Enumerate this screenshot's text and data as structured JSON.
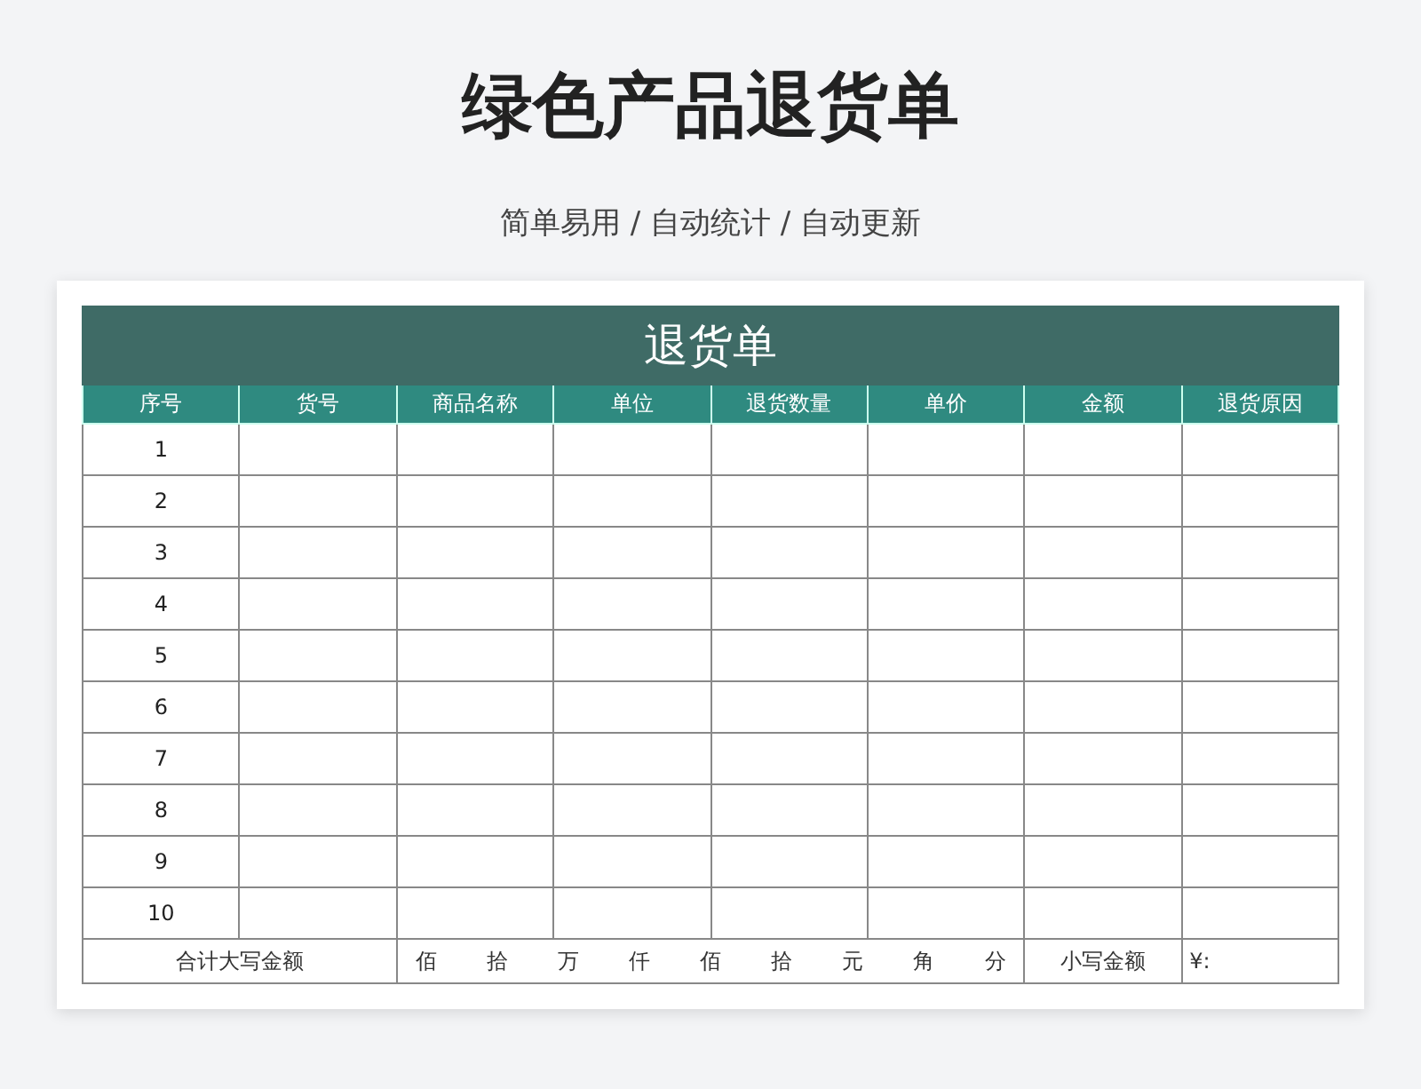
{
  "page": {
    "title": "绿色产品退货单",
    "subtitle": "简单易用 / 自动统计 / 自动更新"
  },
  "sheet": {
    "title": "退货单",
    "columns": [
      "序号",
      "货号",
      "商品名称",
      "单位",
      "退货数量",
      "单价",
      "金额",
      "退货原因"
    ],
    "rows": [
      {
        "number": "1"
      },
      {
        "number": "2"
      },
      {
        "number": "3"
      },
      {
        "number": "4"
      },
      {
        "number": "5"
      },
      {
        "number": "6"
      },
      {
        "number": "7"
      },
      {
        "number": "8"
      },
      {
        "number": "9"
      },
      {
        "number": "10"
      }
    ],
    "total": {
      "label": "合计大写金额",
      "units": [
        "佰",
        "拾",
        "万",
        "仟",
        "佰",
        "拾",
        "元",
        "角",
        "分"
      ],
      "figure_label": "小写金额",
      "currency": "¥:"
    }
  }
}
